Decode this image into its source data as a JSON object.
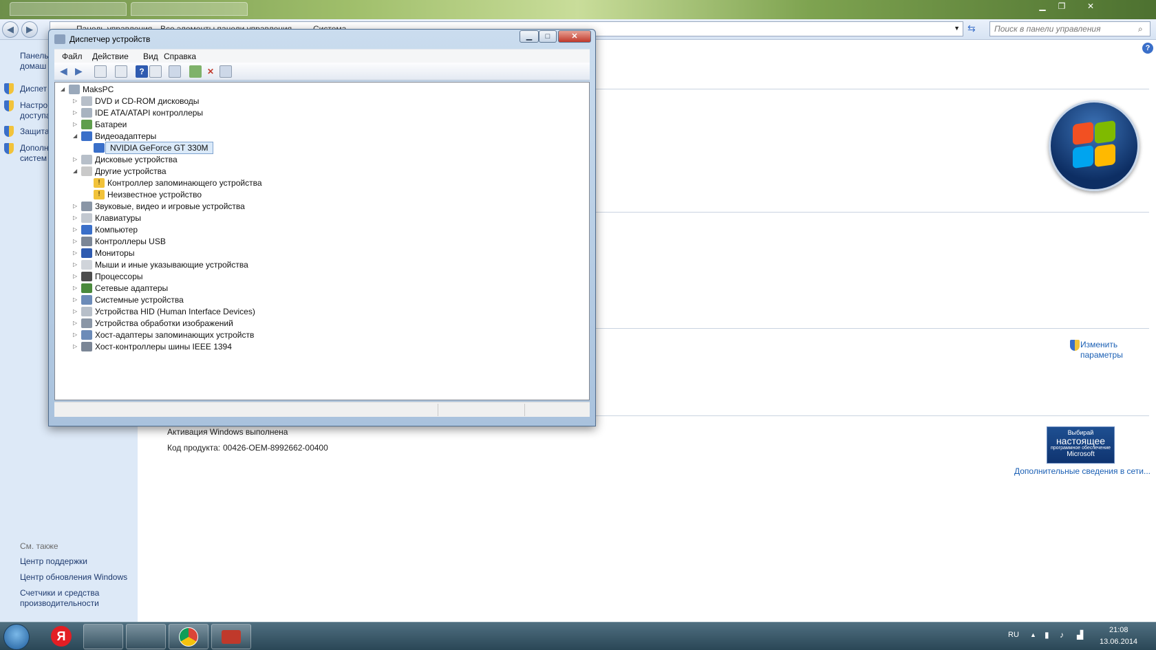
{
  "explorer": {
    "breadcrumbs": [
      "Панель управления",
      "Все элементы панели управления",
      "Система"
    ],
    "search_placeholder": "Поиск в панели управления"
  },
  "sidebar": {
    "top_items": [
      {
        "label": "Панель управления — домашняя страница",
        "visible": "Панель\nдомаш"
      },
      {
        "label": "Диспетчер устройств",
        "visible": "Диспет"
      },
      {
        "label": "Настройка удаленного доступа",
        "visible": "Настро\nдоступа"
      },
      {
        "label": "Защита системы",
        "visible": "Защита"
      },
      {
        "label": "Дополнительные параметры системы",
        "visible": "Дополн\nсистем"
      }
    ],
    "see_also": "См. также",
    "links": [
      "Центр поддержки",
      "Центр обновления Windows",
      "Счетчики и средства\nпроизводительности"
    ]
  },
  "main": {
    "change_settings": "Изменить\nпараметры",
    "activation": "Активация Windows выполнена",
    "product_key_label": "Код продукта:",
    "product_key": "00426-OEM-8992662-00400",
    "genuine_line1": "Выбирай",
    "genuine_line2": "настоящее",
    "genuine_line3": "программное обеспечение",
    "genuine_line4": "Microsoft",
    "more_info": "Дополнительные сведения в сети..."
  },
  "device_manager": {
    "title": "Диспетчер устройств",
    "menu": [
      "Файл",
      "Действие",
      "Вид",
      "Справка"
    ],
    "root": "MaksPC",
    "nodes": [
      "DVD и CD-ROM дисководы",
      "IDE ATA/ATAPI контроллеры",
      "Батареи",
      "Видеоадаптеры",
      "NVIDIA GeForce GT 330M",
      "Дисковые устройства",
      "Другие устройства",
      "Контроллер запоминающего устройства",
      "Неизвестное устройство",
      "Звуковые, видео и игровые устройства",
      "Клавиатуры",
      "Компьютер",
      "Контроллеры USB",
      "Мониторы",
      "Мыши и иные указывающие устройства",
      "Процессоры",
      "Сетевые адаптеры",
      "Системные устройства",
      "Устройства HID (Human Interface Devices)",
      "Устройства обработки изображений",
      "Хост-адаптеры запоминающих устройств",
      "Хост-контроллеры шины IEEE 1394"
    ]
  },
  "taskbar": {
    "lang": "RU",
    "time": "21:08",
    "date": "13.06.2014"
  },
  "colors": {
    "sidebar": "#dde9f7",
    "link": "#1a5fb4",
    "taskbar": "#2a4756"
  }
}
